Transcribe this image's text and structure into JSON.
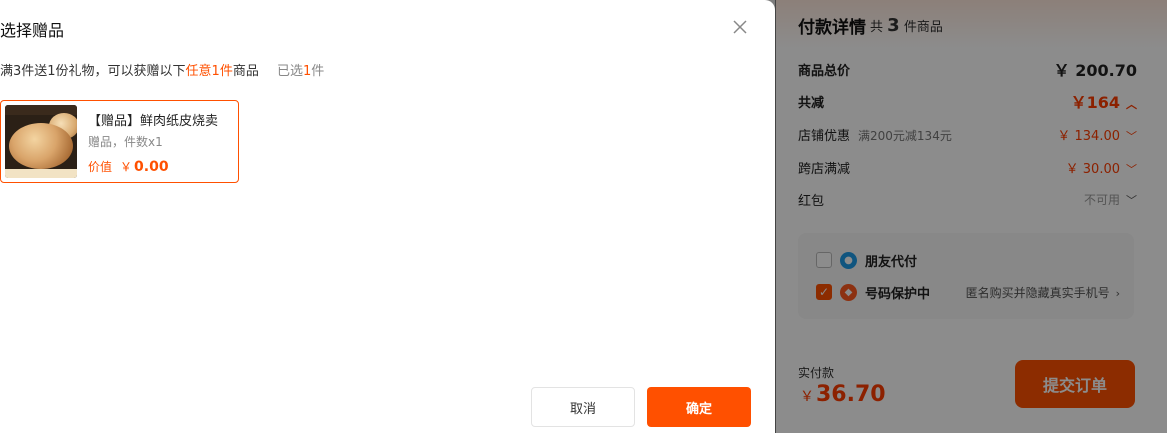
{
  "modal": {
    "title": "选择赠品",
    "rule_prefix": "满3件送1份礼物，可以获赠以下",
    "rule_highlight": "任意1件",
    "rule_suffix": "商品",
    "selected_prefix": "已选",
    "selected_count": "1",
    "selected_suffix": "件",
    "gift": {
      "name": "【赠品】鲜肉纸皮烧卖",
      "meta": "赠品，件数x1",
      "price_label": "价值",
      "currency": "￥",
      "price": "0.00",
      "thumb_icon": "food-photo-icon"
    },
    "cancel_label": "取消",
    "confirm_label": "确定"
  },
  "payment": {
    "title": "付款详情",
    "count_prefix": "共",
    "count": "3",
    "count_suffix": "件商品",
    "total_label": "商品总价",
    "total_value": "￥ 200.70",
    "reduce_label": "共减",
    "reduce_value": "￥164",
    "shop_discount_label": "店铺优惠",
    "shop_discount_note": "满200元减134元",
    "shop_discount_value": "￥ 134.00",
    "cross_shop_label": "跨店满减",
    "cross_shop_value": "￥ 30.00",
    "redpacket_label": "红包",
    "redpacket_value": "不可用",
    "friend_pay_label": "朋友代付",
    "number_protect_label": "号码保护中",
    "number_protect_note": "匿名购买并隐藏真实手机号",
    "actual_label": "实付款",
    "actual_currency": "￥",
    "actual_value": "36.70",
    "submit_label": "提交订单"
  },
  "colors": {
    "accent": "#ff5000",
    "price_red": "#ff3c00",
    "friend_icon": "#1e9be8",
    "protect_icon": "#ff5a1f"
  }
}
